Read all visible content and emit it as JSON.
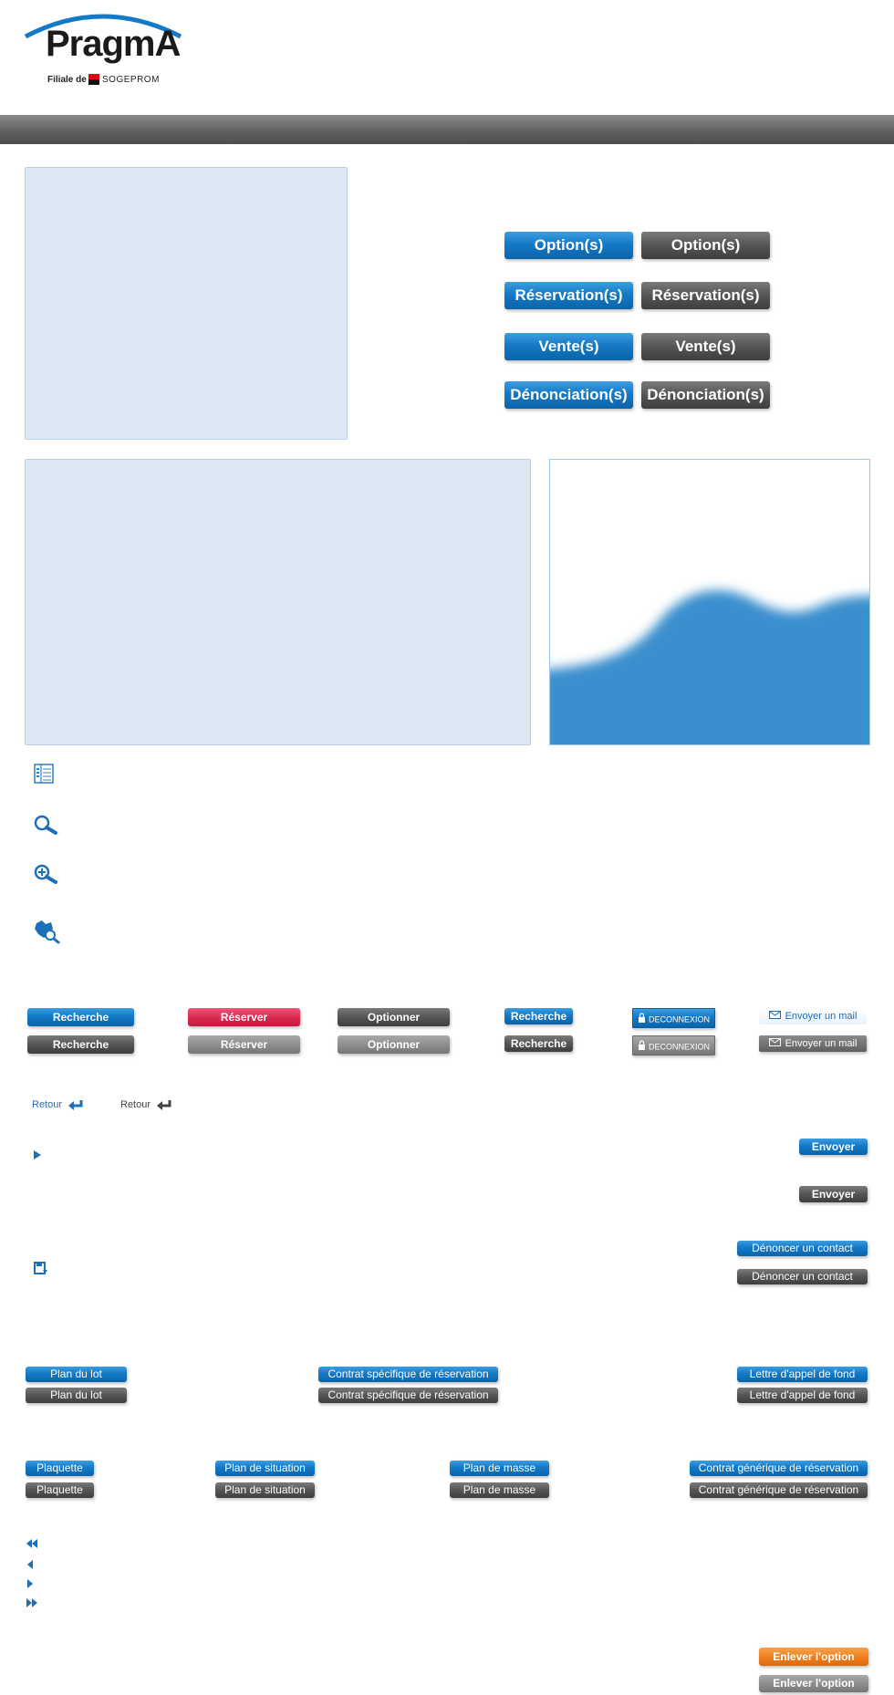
{
  "brand": {
    "name": "PragmA",
    "subtitle": "Filiale de",
    "parent": "SOGEPROM"
  },
  "colors": {
    "blue": "#1479c6",
    "dark": "#555555",
    "gray": "#8c8c8c",
    "red": "#d9284f",
    "orange": "#ee7d1c",
    "panel": "#dce9f5",
    "header_bar": "#6b6b6b"
  },
  "stats_buttons": {
    "options": "Option(s)",
    "reservations": "Réservation(s)",
    "ventes": "Vente(s)",
    "denonciations": "Dénonciation(s)"
  },
  "icons": [
    "list-icon",
    "search-icon",
    "zoom-in-icon",
    "map-search-icon",
    "play-icon",
    "save-icon",
    "first-page-icon",
    "previous-page-icon",
    "next-page-icon",
    "last-page-icon"
  ],
  "actions": {
    "recherche": "Recherche",
    "reserver": "Réserver",
    "optionner": "Optionner",
    "deconnexion": "DECONNEXION",
    "envoyer_mail": "Envoyer un mail"
  },
  "retour": "Retour",
  "envoyer": "Envoyer",
  "denoncer": "Dénoncer un contact",
  "documents": {
    "plan_lot": "Plan du lot",
    "contrat_specifique": "Contrat spécifique de réservation",
    "lettre_appel": "Lettre d'appel de fond",
    "plaquette": "Plaquette",
    "plan_situation": "Plan de situation",
    "plan_masse": "Plan de masse",
    "contrat_generique": "Contrat générique de réservation"
  },
  "enlever_option": "Enlever l'option"
}
